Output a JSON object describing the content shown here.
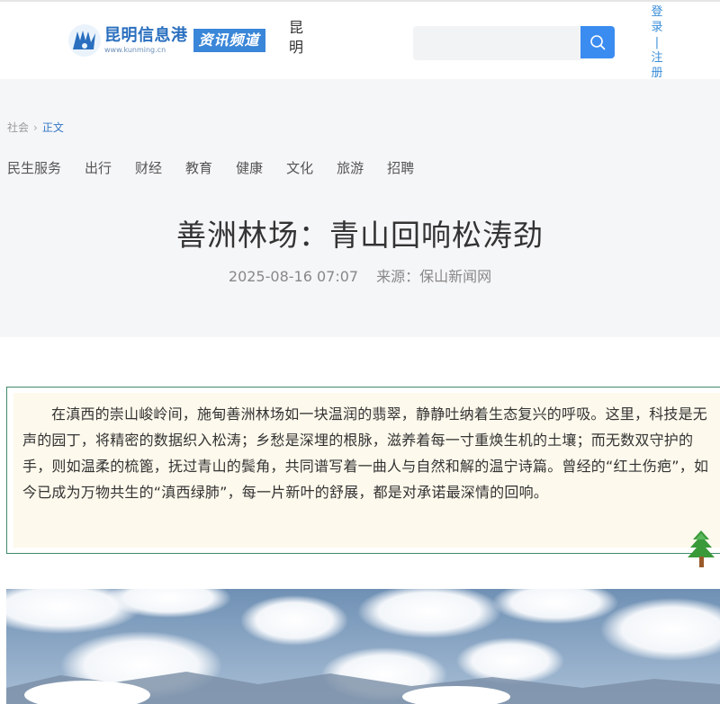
{
  "header": {
    "logo_name": "昆明信息港",
    "logo_url": "www.kunming.cn",
    "channel": "资讯频道",
    "city": "昆明",
    "search": {
      "placeholder": ""
    },
    "login": "登录",
    "register": "注册"
  },
  "breadcrumb": {
    "section": "社会",
    "arrow": "›",
    "current": "正文"
  },
  "nav": [
    "民生服务",
    "出行",
    "财经",
    "教育",
    "健康",
    "文化",
    "旅游",
    "招聘"
  ],
  "article": {
    "title": "善洲林场：青山回响松涛劲",
    "datetime": "2025-08-16 07:07",
    "source": "来源：保山新闻网",
    "summary": "在滇西的崇山峻岭间，施甸善洲林场如一块温润的翡翠，静静吐纳着生态复兴的呼吸。这里，科技是无声的园丁，将精密的数据织入松涛；乡愁是深埋的根脉，滋养着每一寸重焕生机的土壤；而无数双守护的手，则如温柔的梳篦，抚过青山的鬓角，共同谱写着一曲人与自然和解的温宁诗篇。曾经的“红土伤疤”，如今已成为万物共生的“滇西绿肺”，每一片新叶的舒展，都是对承诺最深情的回响。"
  },
  "colors": {
    "accent": "#3b8cf0",
    "link": "#3478c6",
    "summary_bg": "#fdf9ec",
    "summary_border": "#3f8a6a"
  },
  "icons": {
    "search": "search-icon",
    "tree": "pine-tree-icon",
    "logo": "logo-emblem-icon"
  }
}
